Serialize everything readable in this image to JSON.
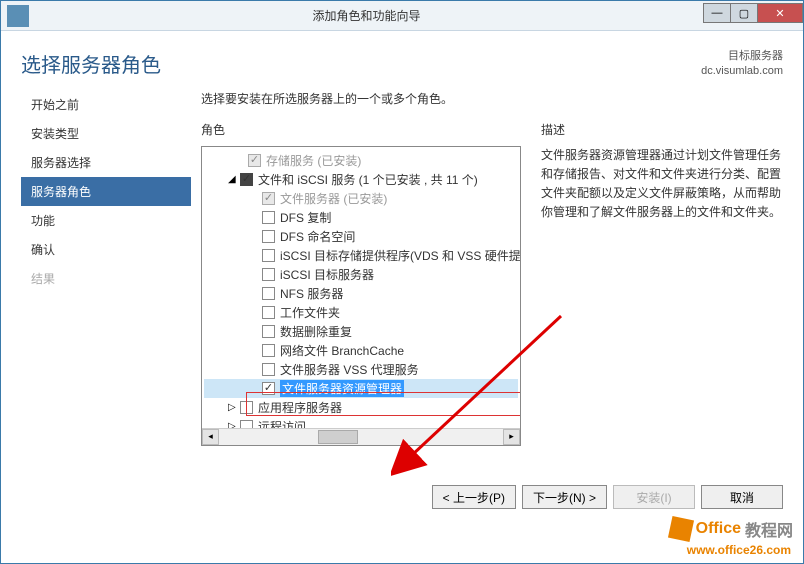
{
  "window": {
    "title": "添加角色和功能向导"
  },
  "page_title": "选择服务器角色",
  "target": {
    "label": "目标服务器",
    "value": "dc.visumlab.com"
  },
  "sidebar": {
    "items": [
      {
        "label": "开始之前"
      },
      {
        "label": "安装类型"
      },
      {
        "label": "服务器选择"
      },
      {
        "label": "服务器角色"
      },
      {
        "label": "功能"
      },
      {
        "label": "确认"
      },
      {
        "label": "结果"
      }
    ]
  },
  "instruction": "选择要安装在所选服务器上的一个或多个角色。",
  "roles_label": "角色",
  "desc_label": "描述",
  "tree": {
    "n0": "存储服务 (已安装)",
    "n1": "文件和 iSCSI 服务 (1 个已安装 , 共 11 个)",
    "n2": "文件服务器 (已安装)",
    "n3": "DFS 复制",
    "n4": "DFS 命名空间",
    "n5": "iSCSI 目标存储提供程序(VDS 和 VSS 硬件提",
    "n6": "iSCSI 目标服务器",
    "n7": "NFS 服务器",
    "n8": "工作文件夹",
    "n9": "数据删除重复",
    "n10": "网络文件 BranchCache",
    "n11": "文件服务器 VSS 代理服务",
    "n12": "文件服务器资源管理器",
    "n13": "应用程序服务器",
    "n14": "远程访问"
  },
  "description": "文件服务器资源管理器通过计划文件管理任务和存储报告、对文件和文件夹进行分类、配置文件夹配额以及定义文件屏蔽策略，从而帮助你管理和了解文件服务器上的文件和文件夹。",
  "buttons": {
    "prev": "< 上一步(P)",
    "next": "下一步(N) >",
    "install": "安装(I)",
    "cancel": "取消"
  },
  "watermark": {
    "t1": "Office",
    "t2": "教程网",
    "sub": "www.office26.com"
  }
}
